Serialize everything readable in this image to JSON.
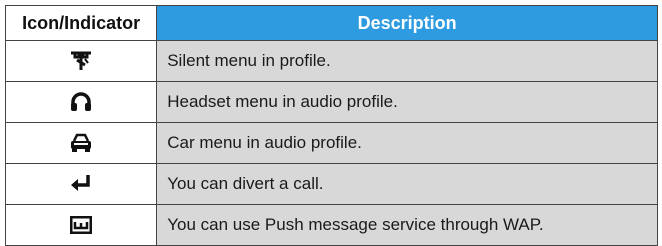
{
  "table": {
    "headers": {
      "icon": "Icon/Indicator",
      "description": "Description"
    },
    "rows": [
      {
        "icon": "silent-profile-icon",
        "description": "Silent menu in profile."
      },
      {
        "icon": "headset-icon",
        "description": "Headset menu in audio profile."
      },
      {
        "icon": "car-icon",
        "description": "Car menu in audio profile."
      },
      {
        "icon": "call-divert-icon",
        "description": "You can divert a call."
      },
      {
        "icon": "wap-push-icon",
        "description": "You can use Push message service through WAP."
      }
    ]
  },
  "colors": {
    "header_accent": "#2e9be0",
    "description_cell": "#d8d8d8",
    "border": "#444444"
  }
}
